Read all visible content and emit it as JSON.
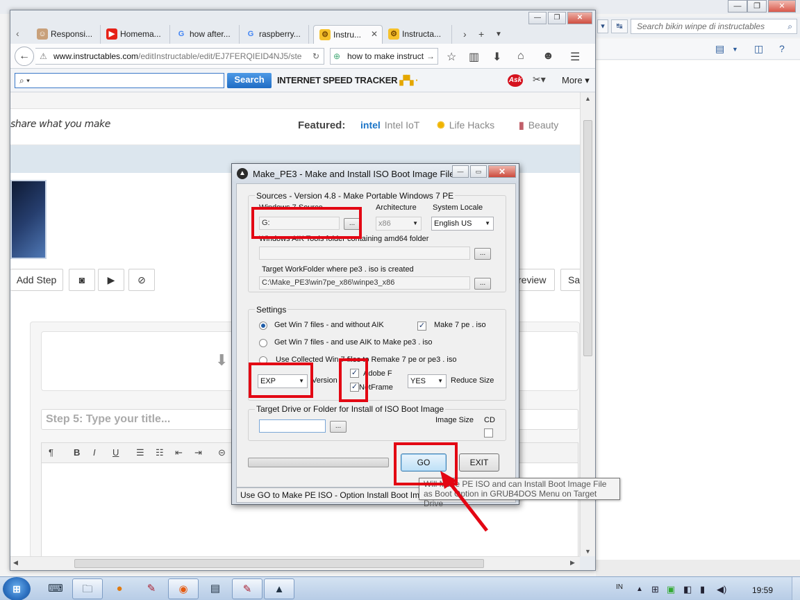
{
  "background_app": {
    "search_placeholder": "Search bikin winpe di instructables",
    "search_icon": "magnifier-icon"
  },
  "browser": {
    "tabs": [
      {
        "label": "Responsi...",
        "icon": "avatar-icon"
      },
      {
        "label": "Homema...",
        "icon": "youtube-icon"
      },
      {
        "label": "how after...",
        "icon": "google-icon"
      },
      {
        "label": "raspberry...",
        "icon": "google-icon"
      },
      {
        "label": "Instru...",
        "icon": "instructables-robot-icon",
        "active": true
      },
      {
        "label": "Instructa...",
        "icon": "instructables-robot-icon"
      }
    ],
    "url_host": "www.instructables.com",
    "url_path": "/editInstructable/edit/EJ7FERQIEID4NJ5/ste",
    "search_engine_text": "how to make instruct",
    "ask_toolbar": {
      "search_button": "Search",
      "speed_tracker": "INTERNET SPEED TRACKER",
      "ask_logo": "Ask",
      "more": "More"
    }
  },
  "page": {
    "tagline": "share what you make",
    "featured_label": "Featured:",
    "featured_items": [
      {
        "label": "Intel IoT",
        "icon": "intel-icon"
      },
      {
        "label": "Life Hacks",
        "icon": "lightbulb-icon"
      },
      {
        "label": "Beauty",
        "icon": "lipstick-icon"
      }
    ],
    "add_step": "Add Step",
    "preview": "review",
    "save": "Sa",
    "step_title_placeholder": "Step 5:  Type your title..."
  },
  "dialog": {
    "title": "Make_PE3 - Make and Install ISO Boot Image File",
    "sources_label": "Sources - Version 4.8 - Make Portable Windows 7 PE",
    "win7_source_label": "Windows 7 Source",
    "win7_source_value": "G:",
    "architecture_label": "Architecture",
    "architecture_value": "x86",
    "locale_label": "System Locale",
    "locale_value": "English US",
    "aik_label": "Windows AIK Tools folder containing  amd64  folder",
    "aik_value": "",
    "workfolder_label": "Target WorkFolder where pe3 . iso is created",
    "workfolder_value": "C:\\Make_PE3\\win7pe_x86\\winpe3_x86",
    "browse": "...",
    "settings_label": "Settings",
    "radio_options": [
      "Get Win 7 files  -  and  without  AIK",
      "Get Win 7 files  -  and  use  AIK  to  Make  pe3 . iso",
      "Use Collected Win 7 files  to  Remake  7 pe or pe3 . iso"
    ],
    "selected_radio": 0,
    "make_iso_label": "Make 7 pe . iso",
    "make_iso_checked": true,
    "version_value": "EXP",
    "version_label": "Version",
    "adobe_label": "Adobe F",
    "adobe_checked": true,
    "netframe_label": "NetFrame",
    "netframe_checked": true,
    "reduce_value": "YES",
    "reduce_label": "Reduce Size",
    "target_label": "Target Drive or Folder for Install of ISO Boot Image",
    "target_value": "",
    "image_size_label": "Image Size",
    "cd_label": "CD",
    "cd_checked": false,
    "progress": 0,
    "go_button": "GO",
    "exit_button": "EXIT",
    "status": "Use GO to Make PE  ISO - Option Install Boot Image File",
    "tooltip_line1": "Will Make PE  ISO  and can Install Boot Image File",
    "tooltip_line2": "as Boot Option in GRUB4DOS Menu on Target Drive"
  },
  "annotations": {
    "color": "#e30613"
  },
  "taskbar": {
    "language": "IN",
    "clock": "19:59",
    "items": [
      {
        "name": "keyboard-icon"
      },
      {
        "name": "file-explorer-icon"
      },
      {
        "name": "orange-app-icon"
      },
      {
        "name": "tool-icon"
      },
      {
        "name": "firefox-icon"
      },
      {
        "name": "notepad-icon"
      },
      {
        "name": "tool-icon-2"
      },
      {
        "name": "make-pe3-icon"
      }
    ]
  }
}
